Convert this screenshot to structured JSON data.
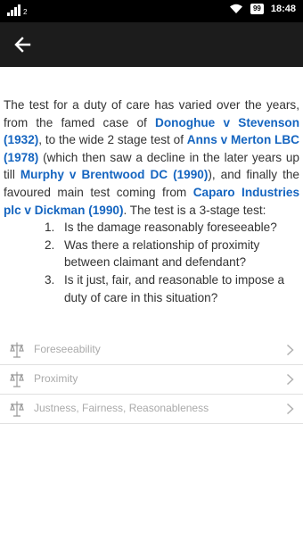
{
  "status_bar": {
    "network_type": "2",
    "battery": "99",
    "time": "18:48",
    "icons": [
      "signal-icon",
      "wifi-icon",
      "battery-icon"
    ]
  },
  "app_bar": {
    "back_icon": "arrow-left-icon"
  },
  "article": {
    "intro_1": "The test for a duty of care has varied over the years, from the famed case of ",
    "case_1": "Donoghue v Stevenson (1932)",
    "intro_2": ", to the wide 2 stage test of ",
    "case_2": "Anns v Merton LBC (1978)",
    "intro_3": " (which then saw a decline in the later years up till ",
    "case_3": "Murphy v Brentwood DC (1990)",
    "intro_4": "), and finally the favoured main test coming from ",
    "case_4": "Caparo Industries plc v Dickman (1990)",
    "intro_5": ". The test is a 3-stage test:",
    "tests": [
      {
        "num": "1.",
        "text": "Is the damage reasonably foreseeable?"
      },
      {
        "num": "2.",
        "text": "Was there a relationship of proximity between claimant and defendant?"
      },
      {
        "num": "3.",
        "text": "Is it just, fair, and reasonable to impose a duty of care in this situation?"
      }
    ],
    "link_color": "#1565c0"
  },
  "topics": [
    {
      "label": "Foreseeability",
      "icon": "scales-icon"
    },
    {
      "label": "Proximity",
      "icon": "scales-icon"
    },
    {
      "label": "Justness, Fairness, Reasonableness",
      "icon": "scales-icon"
    }
  ],
  "colors": {
    "status_bar": "#000000",
    "app_bar": "#1c1c1c",
    "text": "#333333",
    "muted": "#aaaaaa"
  }
}
